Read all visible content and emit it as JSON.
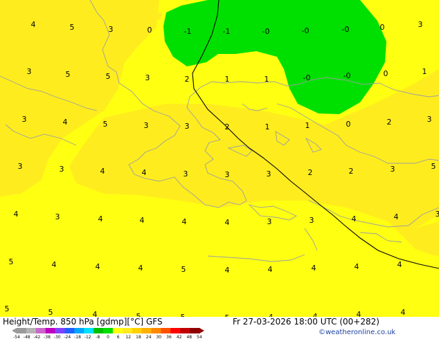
{
  "product": {
    "title": "Height/Temp. 850 hPa [gdmp][°C] GFS",
    "valid_time": "Fr 27-03-2026 18:00 UTC (00+282)",
    "credit": "©weatheronline.co.uk"
  },
  "colors": {
    "field_yellow": "#ffff12",
    "field_gold": "#ffec1e",
    "field_green": "#00e000",
    "coastline": "#9aa0a0",
    "contour_line": "#000000"
  },
  "legend": {
    "ticks": [
      "-54",
      "-48",
      "-42",
      "-38",
      "-30",
      "-24",
      "-18",
      "-12",
      "-8",
      "0",
      "6",
      "12",
      "18",
      "24",
      "30",
      "36",
      "42",
      "48",
      "54"
    ],
    "colors": [
      "#9a9a9a",
      "#b4b4b4",
      "#cc66cc",
      "#c000c0",
      "#8040ff",
      "#2060ff",
      "#00a8ff",
      "#00e0ff",
      "#00c000",
      "#00e000",
      "#ffff12",
      "#ffec1e",
      "#ffd000",
      "#ffb000",
      "#ff8800",
      "#ff5000",
      "#ff0000",
      "#c00000",
      "#900000"
    ]
  },
  "isotherm_labels": [
    "4",
    "5",
    "3",
    "0",
    "-1",
    "-1",
    "-0",
    "-0",
    "-0",
    "0",
    "3",
    "3",
    "5",
    "5",
    "3",
    "2",
    "1",
    "1",
    "-0",
    "-0",
    "0",
    "1",
    "3",
    "4",
    "5",
    "3",
    "3",
    "2",
    "1",
    "1",
    "0",
    "2",
    "3",
    "3",
    "3",
    "4",
    "4",
    "3",
    "3",
    "3",
    "2",
    "2",
    "3",
    "5",
    "4",
    "3",
    "4",
    "4",
    "4",
    "4",
    "3",
    "3",
    "4",
    "4",
    "3",
    "5",
    "4",
    "4",
    "4",
    "5",
    "4",
    "4",
    "4",
    "4",
    "4",
    "5",
    "5",
    "4",
    "5",
    "5",
    "5",
    "4",
    "4",
    "4",
    "4"
  ]
}
